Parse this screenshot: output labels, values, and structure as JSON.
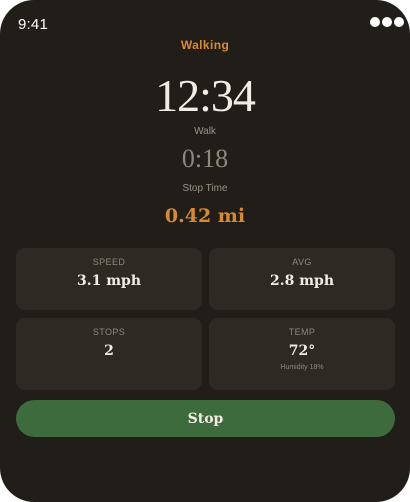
{
  "status_bar": {
    "time": "9:41"
  },
  "activity": {
    "name": "Walking"
  },
  "timer": {
    "main_time": "12:34",
    "main_label": "Walk",
    "stop_time": "0:18",
    "stop_label": "Stop Time"
  },
  "distance": "0.42 mi",
  "stats": {
    "speed": {
      "label": "SPEED",
      "value": "3.1 mph"
    },
    "avg": {
      "label": "AVG",
      "value": "2.8 mph"
    },
    "stops": {
      "label": "STOPS",
      "value": "2"
    },
    "temp": {
      "label": "TEMP",
      "value": "72°",
      "note": "Humidity 18%"
    }
  },
  "actions": {
    "stop_label": "Stop"
  },
  "colors": {
    "background": "#211e19",
    "card": "#2d2923",
    "accent": "#d88a32",
    "stop_button": "#3d6b3d"
  }
}
